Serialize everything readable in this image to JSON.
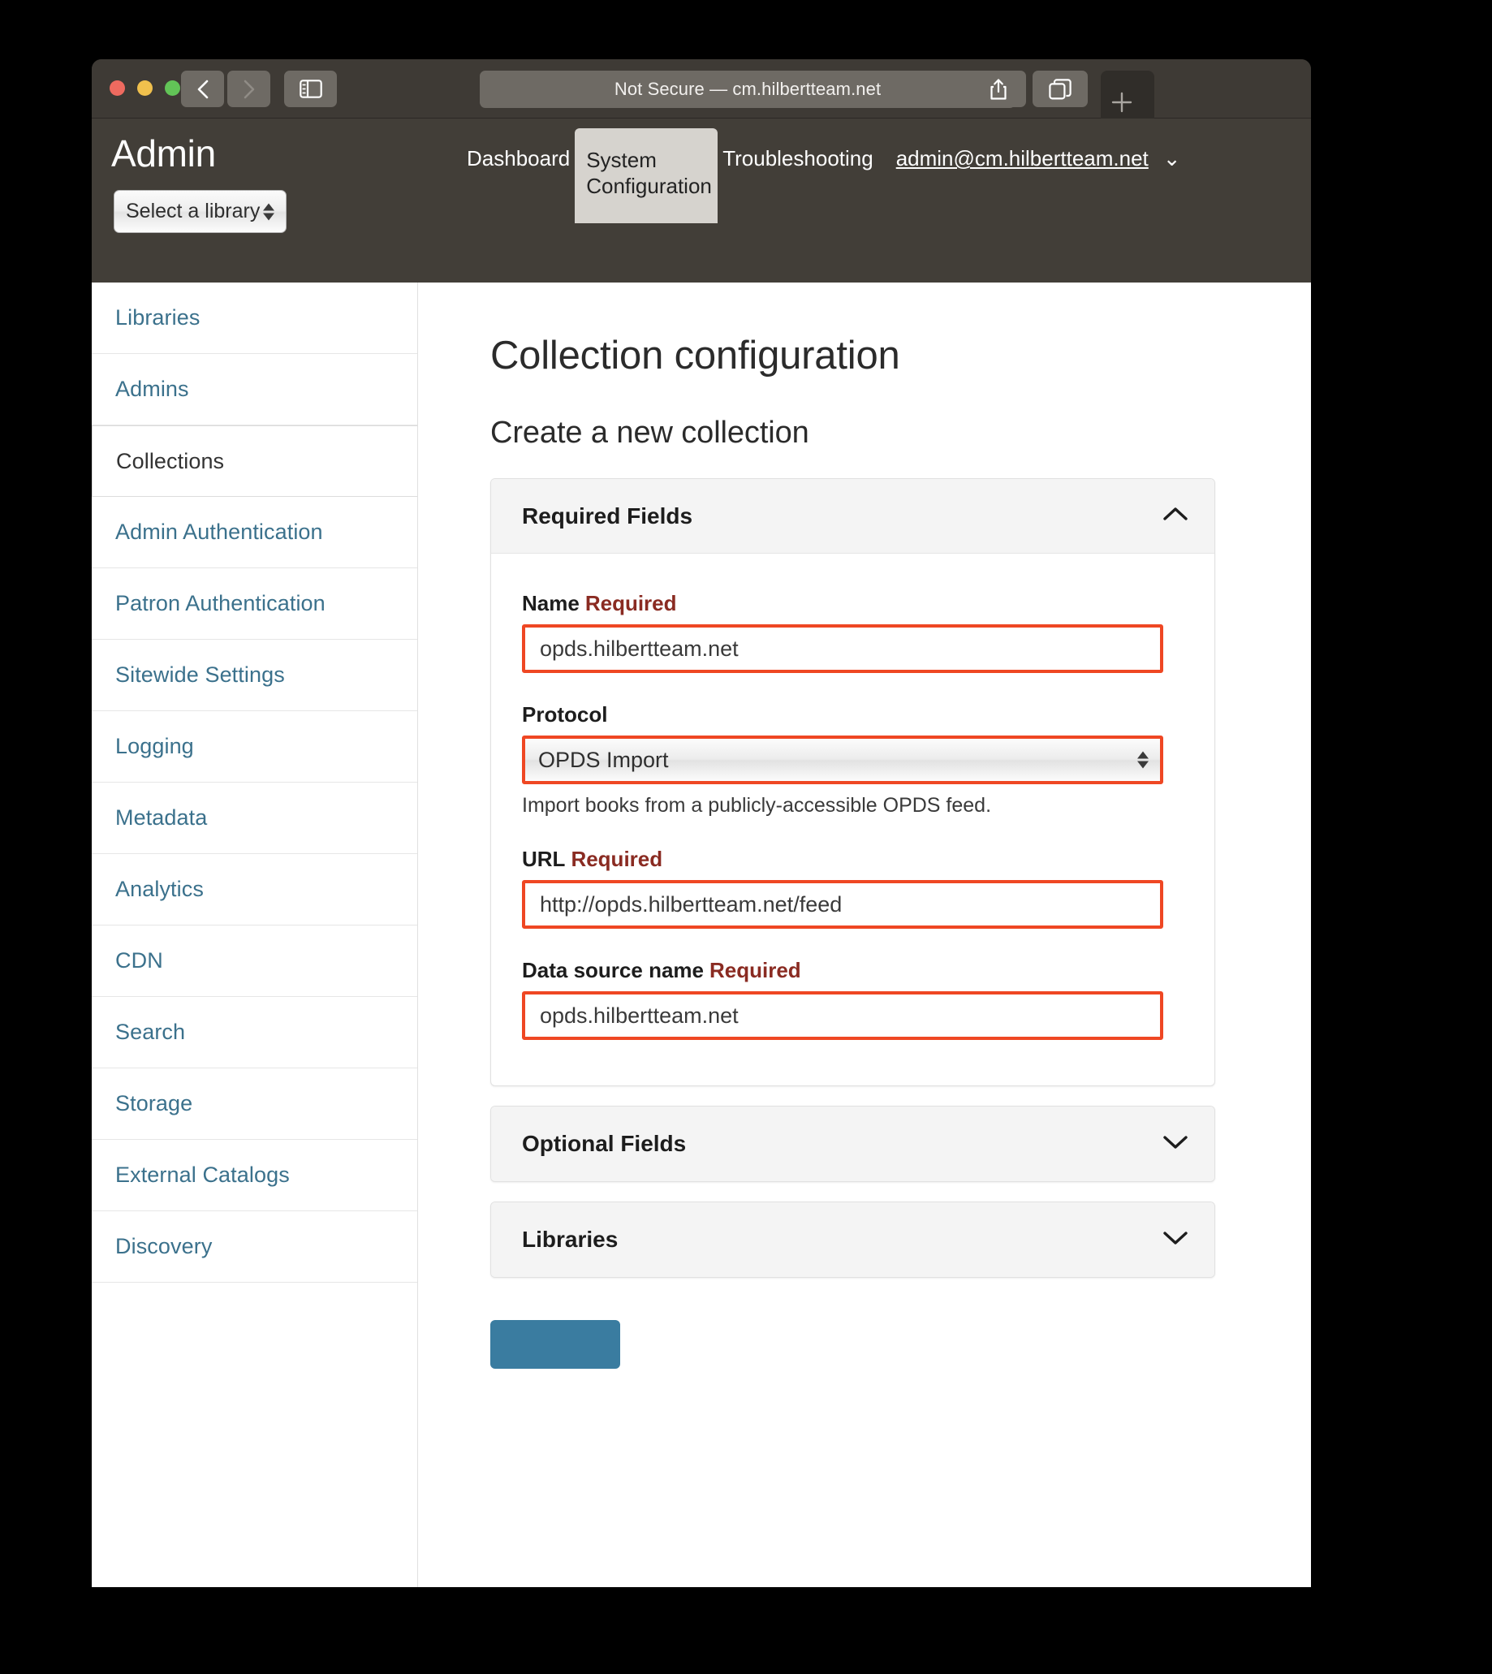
{
  "browser": {
    "url_text": "Not Secure — cm.hilbertteam.net",
    "back_icon": "chevron-left-icon",
    "forward_icon": "chevron-right-icon",
    "sidebar_icon": "sidebar-toggle-icon",
    "reload_icon": "reload-icon",
    "share_icon": "share-icon",
    "tabs_icon": "tab-overview-icon",
    "new_tab_icon": "plus-icon"
  },
  "header": {
    "title": "Admin",
    "library_select_value": "Select a library",
    "nav": [
      {
        "label": "Dashboard",
        "active": false
      },
      {
        "label": "System Configuration",
        "active": true
      },
      {
        "label": "Troubleshooting",
        "active": false
      }
    ],
    "user_email": "admin@cm.hilbertteam.net",
    "user_caret": "⌄"
  },
  "sidebar": {
    "items": [
      {
        "label": "Libraries",
        "active": false
      },
      {
        "label": "Admins",
        "active": false
      },
      {
        "label": "Collections",
        "active": true
      },
      {
        "label": "Admin Authentication",
        "active": false
      },
      {
        "label": "Patron Authentication",
        "active": false
      },
      {
        "label": "Sitewide Settings",
        "active": false
      },
      {
        "label": "Logging",
        "active": false
      },
      {
        "label": "Metadata",
        "active": false
      },
      {
        "label": "Analytics",
        "active": false
      },
      {
        "label": "CDN",
        "active": false
      },
      {
        "label": "Search",
        "active": false
      },
      {
        "label": "Storage",
        "active": false
      },
      {
        "label": "External Catalogs",
        "active": false
      },
      {
        "label": "Discovery",
        "active": false
      }
    ]
  },
  "main": {
    "page_title": "Collection configuration",
    "section_title": "Create a new collection",
    "panels": {
      "required": {
        "title": "Required Fields",
        "expanded": true,
        "chevron": "chevron-up-icon"
      },
      "optional": {
        "title": "Optional Fields",
        "expanded": false,
        "chevron": "chevron-down-icon"
      },
      "libraries": {
        "title": "Libraries",
        "expanded": false,
        "chevron": "chevron-down-icon"
      }
    },
    "fields": {
      "name": {
        "label": "Name",
        "required_badge": "Required",
        "value": "opds.hilbertteam.net"
      },
      "protocol": {
        "label": "Protocol",
        "value": "OPDS Import",
        "help": "Import books from a publicly-accessible OPDS feed."
      },
      "url": {
        "label": "URL",
        "required_badge": "Required",
        "value": "http://opds.hilbertteam.net/feed"
      },
      "data_source_name": {
        "label": "Data source name",
        "required_badge": "Required",
        "value": "opds.hilbertteam.net"
      }
    },
    "submit_label": ""
  },
  "colors": {
    "chrome_bg": "#3e3a35",
    "header_bg": "#423e38",
    "nav_active_bg": "#d6d3ce",
    "sidebar_link": "#3b718c",
    "required_outline": "#ef4723",
    "required_badge": "#8a2b22",
    "submit_blue": "#3a7ca0"
  }
}
